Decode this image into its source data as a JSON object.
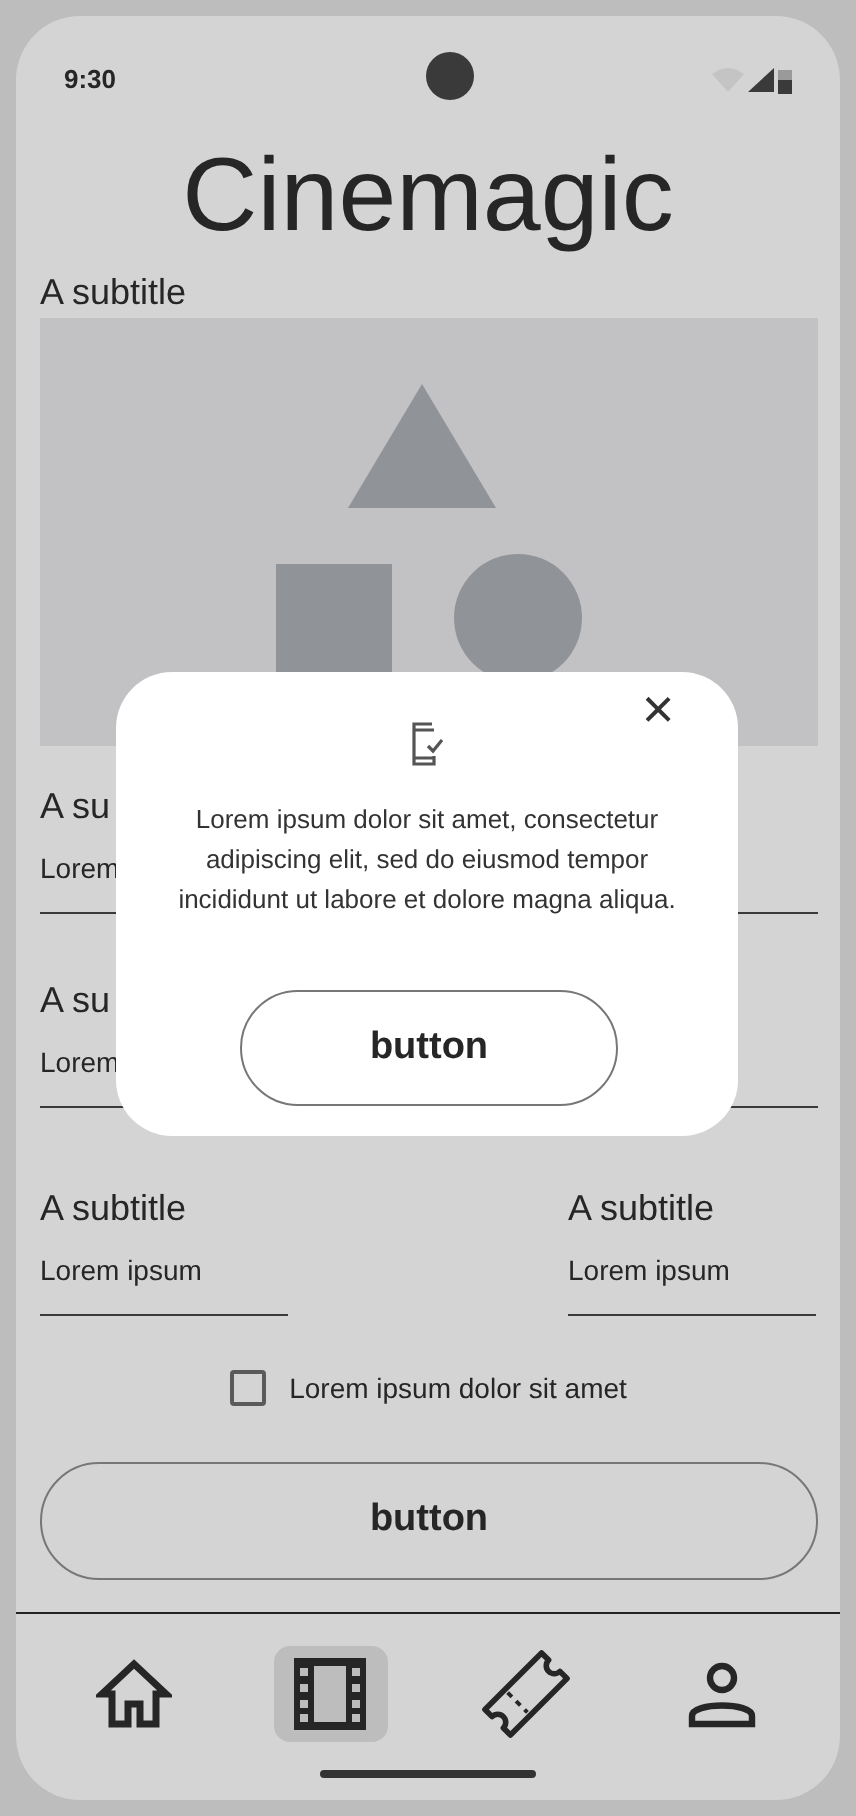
{
  "status_bar": {
    "time": "9:30"
  },
  "app_title": "Cinemagic",
  "hero": {
    "subtitle": "A subtitle",
    "kind": "picture"
  },
  "fields": [
    {
      "subtitle": "A su",
      "value": "Lorem"
    },
    {
      "subtitle": "A su",
      "value": "Lorem"
    }
  ],
  "field_pair": [
    {
      "subtitle": "A subtitle",
      "value": "Lorem ipsum"
    },
    {
      "subtitle": "A subtitle",
      "value": "Lorem ipsum"
    }
  ],
  "checkbox": {
    "label": "Lorem ipsum dolor sit amet",
    "checked": false
  },
  "main_button": "button",
  "nav": [
    {
      "kind": "home",
      "selected": false
    },
    {
      "kind": "film",
      "selected": true
    },
    {
      "kind": "ticket",
      "selected": false
    },
    {
      "kind": "person",
      "selected": false
    }
  ],
  "dialog": {
    "message": "Lorem ipsum dolor sit amet, consectetur adipiscing elit, sed do eiusmod tempor incididunt ut labore et dolore magna aliqua.",
    "button": "button",
    "close": "×"
  }
}
